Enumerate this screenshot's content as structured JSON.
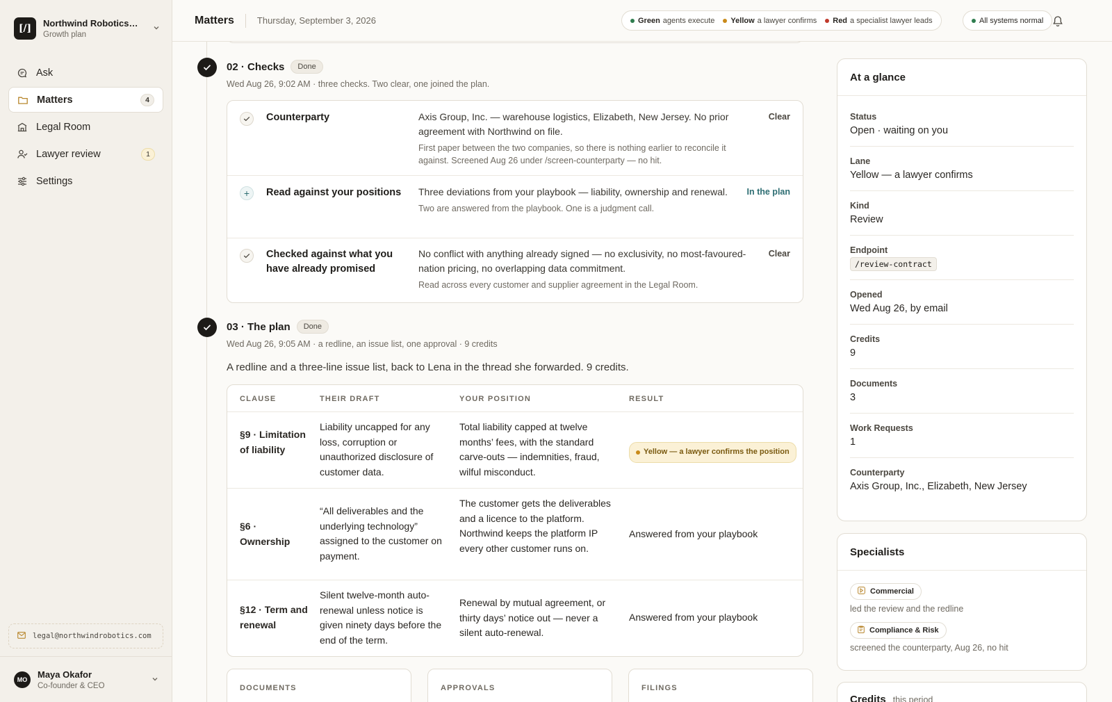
{
  "org": {
    "name": "Northwind Robotics, ...",
    "plan": "Growth plan",
    "logo": "[/]"
  },
  "nav": [
    {
      "label": "Ask",
      "icon": "chat-icon",
      "count": ""
    },
    {
      "label": "Matters",
      "icon": "folder-icon",
      "count": "4"
    },
    {
      "label": "Legal Room",
      "icon": "building-icon",
      "count": ""
    },
    {
      "label": "Lawyer review",
      "icon": "person-icon",
      "count": "1"
    },
    {
      "label": "Settings",
      "icon": "sliders-icon",
      "count": ""
    }
  ],
  "email": "legal@northwindrobotics.com",
  "user": {
    "initials": "MO",
    "name": "Maya Okafor",
    "role": "Co-founder & CEO"
  },
  "header": {
    "title": "Matters",
    "date": "Thursday, September 3, 2026",
    "lanes": [
      {
        "name": "Green",
        "text": "agents execute",
        "color": "#2f7d4f"
      },
      {
        "name": "Yellow",
        "text": "a lawyer confirms",
        "color": "#c98a1a"
      },
      {
        "name": "Red",
        "text": "a specialist lawyer leads",
        "color": "#c0392b"
      }
    ],
    "system_status": "All systems normal",
    "system_color": "#2f7d4f"
  },
  "steps": {
    "checks": {
      "title": "02 · Checks",
      "badge": "Done",
      "meta": "Wed Aug 26, 9:02 AM · three checks. Two clear, one joined the plan.",
      "rows": [
        {
          "name": "Counterparty",
          "desc": "Axis Group, Inc. — warehouse logistics, Elizabeth, New Jersey. No prior agreement with Northwind on file.",
          "note": "First paper between the two companies, so there is nothing earlier to reconcile it against. Screened Aug 26 under /screen-counterparty — no hit.",
          "status": "Clear"
        },
        {
          "name": "Read against your positions",
          "desc": "Three deviations from your playbook — liability, ownership and renewal.",
          "note": "Two are answered from the playbook. One is a judgment call.",
          "status": "In the plan"
        },
        {
          "name": "Checked against what you have already promised",
          "desc": "No conflict with anything already signed — no exclusivity, no most-favoured-nation pricing, no overlapping data commitment.",
          "note": "Read across every customer and supplier agreement in the Legal Room.",
          "status": "Clear"
        }
      ]
    },
    "plan": {
      "title": "03 · The plan",
      "badge": "Done",
      "meta": "Wed Aug 26, 9:05 AM · a redline, an issue list, one approval · 9 credits",
      "summary": "A redline and a three-line issue list, back to Lena in the thread she forwarded. 9 credits.",
      "columns": [
        "CLAUSE",
        "THEIR DRAFT",
        "YOUR POSITION",
        "RESULT"
      ],
      "rows": [
        {
          "clause": "§9 · Limitation of liability",
          "draft": "Liability uncapped for any loss, corruption or unauthorized disclosure of customer data.",
          "position": "Total liability capped at twelve months’ fees, with the standard carve-outs — indemnities, fraud, wilful misconduct.",
          "result": "Yellow — a lawyer confirms the position"
        },
        {
          "clause": "§6 · Ownership",
          "draft": "“All deliverables and the underlying technology” assigned to the customer on payment.",
          "position": "The customer gets the deliverables and a licence to the platform. Northwind keeps the platform IP every other customer runs on.",
          "result": "Answered from your playbook"
        },
        {
          "clause": "§12 · Term and renewal",
          "draft": "Silent twelve-month auto-renewal unless notice is given ninety days before the end of the term.",
          "position": "Renewal by mutual agreement, or thirty days’ notice out — never a silent auto-renewal.",
          "result": "Answered from your playbook"
        }
      ]
    },
    "bottom_cards": [
      "DOCUMENTS",
      "APPROVALS",
      "FILINGS"
    ]
  },
  "glance": {
    "title": "At a glance",
    "items": [
      {
        "k": "Status",
        "v": "Open · waiting on you"
      },
      {
        "k": "Lane",
        "v": "Yellow — a lawyer confirms"
      },
      {
        "k": "Kind",
        "v": "Review"
      },
      {
        "k": "Endpoint",
        "v": "/review-contract"
      },
      {
        "k": "Opened",
        "v": "Wed Aug 26, by email"
      },
      {
        "k": "Credits",
        "v": "9"
      },
      {
        "k": "Documents",
        "v": "3"
      },
      {
        "k": "Work Requests",
        "v": "1"
      },
      {
        "k": "Counterparty",
        "v": "Axis Group, Inc., Elizabeth, New Jersey"
      }
    ]
  },
  "specialists": {
    "title": "Specialists",
    "items": [
      {
        "name": "Commercial",
        "note": "led the review and the redline"
      },
      {
        "name": "Compliance & Risk",
        "note": "screened the counterparty, Aug 26, no hit"
      }
    ]
  },
  "credits": {
    "title": "Credits",
    "period": "this period"
  }
}
